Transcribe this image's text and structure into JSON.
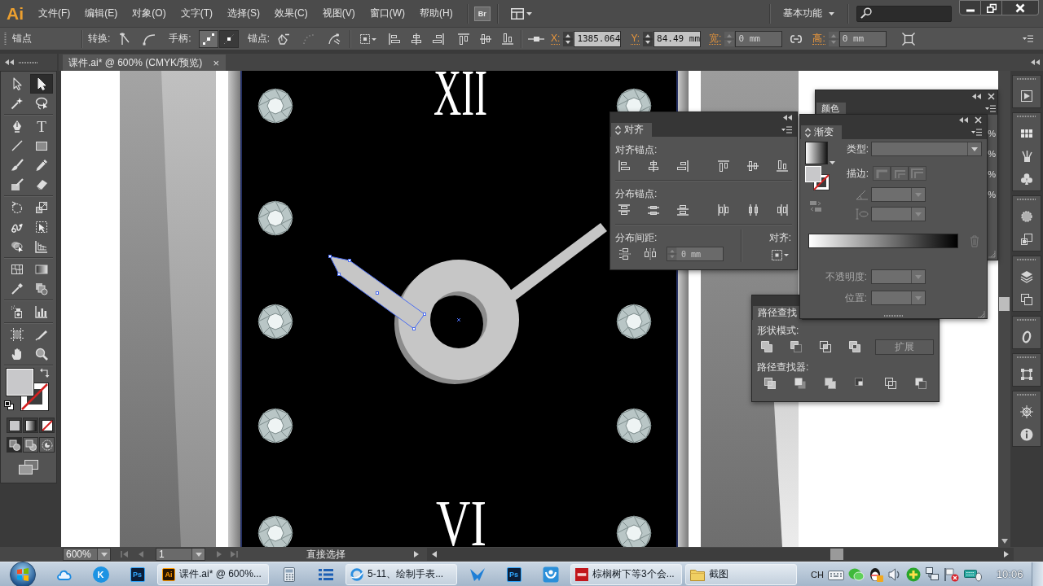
{
  "menu_bar": {
    "logo": "Ai",
    "menus": [
      "文件(F)",
      "编辑(E)",
      "对象(O)",
      "文字(T)",
      "选择(S)",
      "效果(C)",
      "视图(V)",
      "窗口(W)",
      "帮助(H)"
    ],
    "bridge": "Br",
    "workspace": "基本功能"
  },
  "control_bar": {
    "title": "锚点",
    "convert_label": "转换:",
    "handles_label": "手柄:",
    "handle_buttons": [
      {
        "selected": true
      },
      {
        "selected": false
      }
    ],
    "anchors_label": "锚点:",
    "anchor_buttons": [
      {
        "disabled": false
      },
      {
        "disabled": true
      },
      {
        "disabled": false
      }
    ],
    "fields": [
      {
        "label": "X:",
        "value": "1385.064",
        "disabled": false
      },
      {
        "label": "Y:",
        "value": "84.49 mm",
        "disabled": false
      },
      {
        "label": "宽:",
        "value": "0 mm",
        "disabled": true
      },
      {
        "label": "高:",
        "value": "0 mm",
        "disabled": true
      }
    ]
  },
  "document_tab": {
    "title": "课件.ai* @ 600% (CMYK/预览)",
    "close": "×"
  },
  "tools": [
    {
      "selected": false
    },
    {
      "selected": true
    },
    {
      "selected": false
    },
    {
      "selected": false
    },
    {
      "selected": false
    },
    {
      "selected": false,
      "glyph": "T"
    },
    {
      "selected": false
    },
    {
      "selected": false
    },
    {
      "selected": false
    },
    {
      "selected": false
    },
    {
      "selected": false
    },
    {
      "selected": false
    },
    {
      "selected": false
    },
    {
      "selected": false
    },
    {
      "selected": false
    },
    {
      "selected": false
    },
    {
      "selected": false
    },
    {
      "selected": false
    },
    {
      "selected": false
    },
    {
      "selected": false
    },
    {
      "selected": false
    },
    {
      "selected": false
    },
    {
      "selected": false
    },
    {
      "selected": false
    },
    {
      "selected": false
    },
    {
      "selected": false
    },
    {
      "selected": false
    },
    {
      "selected": false
    }
  ],
  "draw_modes": [
    {
      "selected": true
    },
    {
      "selected": false
    },
    {
      "selected": false
    }
  ],
  "canvas": {
    "numerals": [
      "XII",
      "VI"
    ],
    "hour_hand": {
      "selected": true
    }
  },
  "align_panel": {
    "tab": "对齐",
    "sections": [
      "对齐锚点:",
      "分布锚点:"
    ],
    "spacing_label": "分布间距:",
    "spacing_value": "0 mm",
    "align_to_label": "对齐:"
  },
  "color_panel": {
    "tab": "颜色",
    "units": [
      "%",
      "%",
      "%",
      "%"
    ]
  },
  "gradient_panel": {
    "tab": "渐变",
    "type_label": "类型:",
    "stroke_label": "描边:",
    "opacity_label": "不透明度:",
    "location_label": "位置:"
  },
  "pathfinder_panel": {
    "tab": "路径查找",
    "shape_modes_label": "形状模式:",
    "expand": {
      "label": "扩展",
      "disabled": true
    },
    "pathfinders_label": "路径查找器:"
  },
  "status_bar": {
    "zoom": "600%",
    "artboard": "1",
    "tool": "直接选择"
  },
  "taskbar": {
    "items": [
      {
        "kind": "pin"
      },
      {
        "kind": "pin",
        "badge": "K"
      },
      {
        "kind": "pin",
        "badge": "Ps"
      },
      {
        "kind": "task",
        "badge": "Ai",
        "title": "课件.ai* @ 600%..."
      },
      {
        "kind": "pin"
      },
      {
        "kind": "pin"
      },
      {
        "kind": "task",
        "title": "5-11、绘制手表..."
      },
      {
        "kind": "pin"
      },
      {
        "kind": "pin",
        "badge": "Ps"
      },
      {
        "kind": "pin"
      },
      {
        "kind": "task",
        "title": "棕榈树下等3个会..."
      },
      {
        "kind": "task",
        "title": "截图"
      }
    ],
    "input_language": "CH",
    "clock": "10:06"
  }
}
